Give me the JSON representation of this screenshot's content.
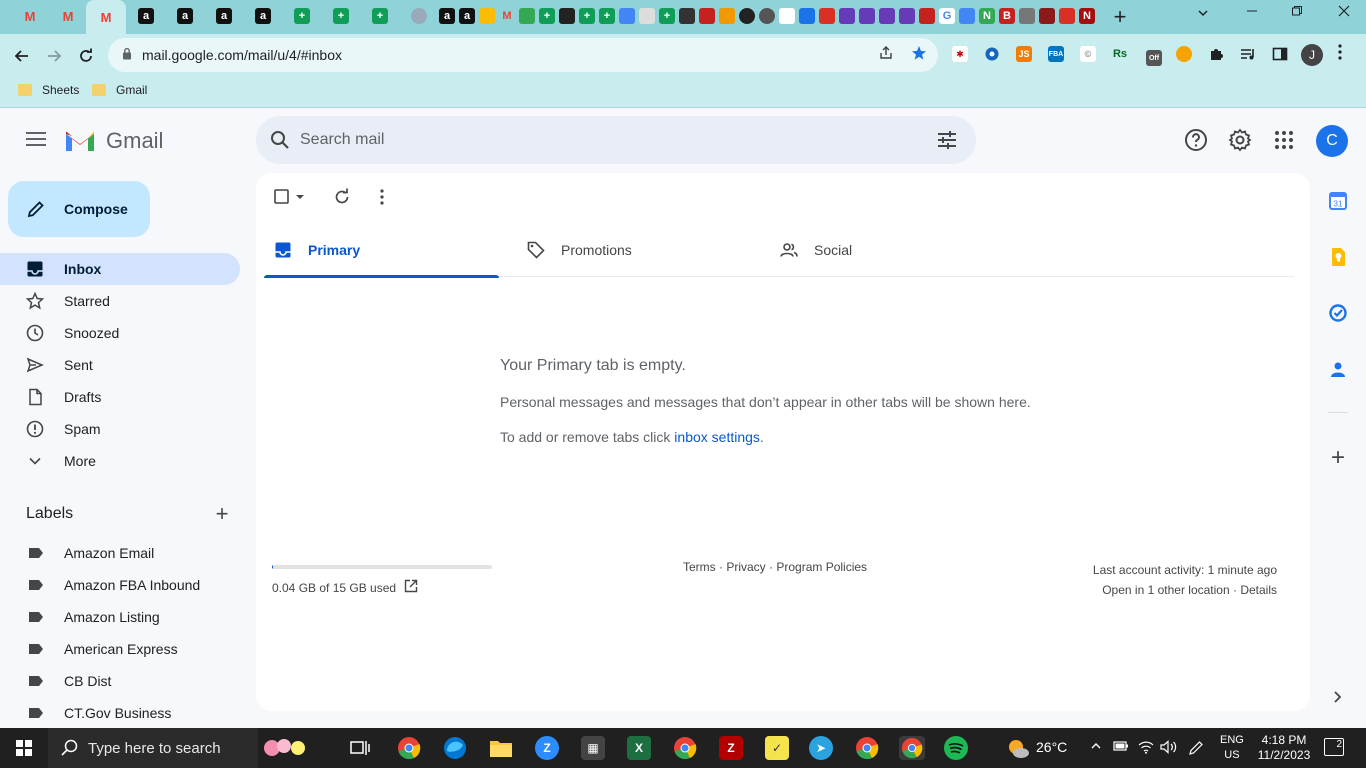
{
  "browser": {
    "tabs": [
      {
        "icon": "gmail-icon",
        "color": "#ea4335",
        "glyph": "M"
      },
      {
        "icon": "gmail-icon",
        "color": "#ea4335",
        "glyph": "M"
      },
      {
        "icon": "gmail-icon",
        "color": "#ea4335",
        "glyph": "M",
        "active": true
      },
      {
        "icon": "amazon-icon",
        "color": "#111111",
        "glyph": "a"
      },
      {
        "icon": "amazon-icon",
        "color": "#111111",
        "glyph": "a"
      },
      {
        "icon": "amazon-icon",
        "color": "#111111",
        "glyph": "a"
      },
      {
        "icon": "amazon-icon",
        "color": "#111111",
        "glyph": "a"
      },
      {
        "icon": "sheets-icon",
        "color": "#0f9d58",
        "glyph": "+"
      },
      {
        "icon": "sheets-icon",
        "color": "#0f9d58",
        "glyph": "+"
      },
      {
        "icon": "sheets-icon",
        "color": "#0f9d58",
        "glyph": "+"
      }
    ],
    "new_tab_label": "+",
    "url": "mail.google.com/mail/u/4/#inbox",
    "profile_initial": "J",
    "bookmarks": [
      {
        "label": "Sheets"
      },
      {
        "label": "Gmail"
      }
    ]
  },
  "gmail": {
    "brand": "Gmail",
    "search_placeholder": "Search mail",
    "account_initial": "C",
    "compose_label": "Compose",
    "nav": [
      {
        "label": "Inbox",
        "icon": "inbox-icon",
        "active": true
      },
      {
        "label": "Starred",
        "icon": "star-icon"
      },
      {
        "label": "Snoozed",
        "icon": "clock-icon"
      },
      {
        "label": "Sent",
        "icon": "send-icon"
      },
      {
        "label": "Drafts",
        "icon": "draft-icon"
      },
      {
        "label": "Spam",
        "icon": "spam-icon"
      },
      {
        "label": "More",
        "icon": "chevron-down-icon"
      }
    ],
    "labels_title": "Labels",
    "labels": [
      {
        "label": "Amazon Email"
      },
      {
        "label": "Amazon FBA Inbound"
      },
      {
        "label": "Amazon Listing"
      },
      {
        "label": "American Express"
      },
      {
        "label": "CB Dist"
      },
      {
        "label": "CT.Gov Business"
      }
    ],
    "category_tabs": [
      {
        "label": "Primary",
        "icon": "inbox-icon",
        "active": true
      },
      {
        "label": "Promotions",
        "icon": "tag-icon"
      },
      {
        "label": "Social",
        "icon": "people-icon"
      }
    ],
    "empty_state": {
      "title": "Your Primary tab is empty.",
      "description": "Personal messages and messages that don’t appear in other tabs will be shown here.",
      "settings_prefix": "To add or remove tabs click ",
      "settings_link": "inbox settings",
      "settings_suffix": "."
    },
    "storage": {
      "text": "0.04 GB of 15 GB used",
      "fraction": 0.003
    },
    "footer": {
      "terms": "Terms",
      "privacy": "Privacy",
      "policies": "Program Policies",
      "separator": " · "
    },
    "activity": {
      "last": "Last account activity: 1 minute ago",
      "other_location": "Open in 1 other location",
      "details": "Details"
    }
  },
  "taskbar": {
    "search_placeholder": "Type here to search",
    "weather": "26°C",
    "lang_top": "ENG",
    "lang_bottom": "US",
    "time": "4:18 PM",
    "date": "11/2/2023",
    "notifications": "2"
  },
  "colors": {
    "chrome_frame": "#8fd3d8",
    "accent_blue": "#0b57d0",
    "compose_bg": "#c2e7ff",
    "nav_active_bg": "#d3e3fd"
  }
}
